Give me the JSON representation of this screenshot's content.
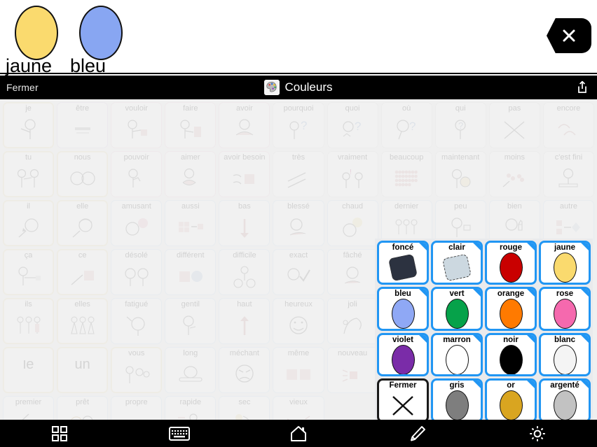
{
  "app": {
    "title": "Couleurs",
    "title_icon": "palette-icon"
  },
  "message_bar": {
    "items": [
      {
        "label": "jaune",
        "color": "#FADA6E"
      },
      {
        "label": "bleu",
        "color": "#88A6F2"
      }
    ],
    "clear_label": "clear-x-icon"
  },
  "title_bar": {
    "close_label": "Fermer",
    "share_icon": "share-icon"
  },
  "color_popup": {
    "cells": [
      {
        "label": "foncé",
        "color": "#2c3240",
        "shape": "rotsq",
        "type": "color"
      },
      {
        "label": "clair",
        "color": "#ccd8e0",
        "shape": "rotsq",
        "type": "color"
      },
      {
        "label": "rouge",
        "color": "#C90000",
        "shape": "oval",
        "type": "color"
      },
      {
        "label": "jaune",
        "color": "#FADA6E",
        "shape": "oval",
        "type": "color"
      },
      {
        "label": "bleu",
        "color": "#8FA8F5",
        "shape": "oval",
        "type": "color"
      },
      {
        "label": "vert",
        "color": "#06A24A",
        "shape": "oval",
        "type": "color"
      },
      {
        "label": "orange",
        "color": "#FF7A00",
        "shape": "oval",
        "type": "color"
      },
      {
        "label": "rose",
        "color": "#F569AE",
        "shape": "oval",
        "type": "color"
      },
      {
        "label": "violet",
        "color": "#7A2CA8",
        "shape": "oval",
        "type": "color"
      },
      {
        "label": "marron",
        "color": "#8C6murky",
        "shape": "oval",
        "type": "color"
      },
      {
        "label": "noir",
        "color": "#000000",
        "shape": "oval",
        "type": "color"
      },
      {
        "label": "blanc",
        "color": "#F4F4F4",
        "shape": "oval",
        "type": "color"
      },
      {
        "label": "Fermer",
        "color": "#000000",
        "shape": "cross",
        "type": "close"
      },
      {
        "label": "gris",
        "color": "#7E7E7E",
        "shape": "oval",
        "type": "color"
      },
      {
        "label": "or",
        "color": "#D9A520",
        "shape": "oval",
        "type": "color"
      },
      {
        "label": "argenté",
        "color": "#C2C2C2",
        "shape": "oval",
        "type": "color"
      }
    ]
  },
  "board": {
    "rows": [
      [
        {
          "label": "je",
          "tint": "yellow",
          "art": "person-point-self"
        },
        {
          "label": "être",
          "tint": "purple",
          "art": "equals-bar"
        },
        {
          "label": "vouloir",
          "tint": "pink",
          "art": "person-reach-box"
        },
        {
          "label": "faire",
          "tint": "pink",
          "art": "person-build"
        },
        {
          "label": "avoir",
          "tint": "pink",
          "art": "person-hold"
        },
        {
          "label": "pourquoi",
          "tint": "grey",
          "art": "person-question"
        },
        {
          "label": "quoi",
          "tint": "grey",
          "art": "face-question"
        },
        {
          "label": "où",
          "tint": "grey",
          "art": "balloon-question"
        },
        {
          "label": "qui",
          "tint": "grey",
          "art": "person-question2"
        },
        {
          "label": "pas",
          "tint": "grey",
          "art": "cross-slash"
        },
        {
          "label": "encore",
          "tint": "grey",
          "art": "arrows-repeat"
        }
      ],
      [
        {
          "label": "tu",
          "tint": "yellow",
          "art": "two-people-point"
        },
        {
          "label": "nous",
          "tint": "yellow",
          "art": "two-faces"
        },
        {
          "label": "pouvoir",
          "tint": "pink",
          "art": "person-flex"
        },
        {
          "label": "aimer",
          "tint": "pink",
          "art": "person-heart"
        },
        {
          "label": "avoir besoin",
          "tint": "pink",
          "art": "hands-box"
        },
        {
          "label": "très",
          "tint": "grey",
          "art": "lines-up"
        },
        {
          "label": "vraiment",
          "tint": "grey",
          "art": "two-people-talk"
        },
        {
          "label": "beaucoup",
          "tint": "grey",
          "art": "many-dots"
        },
        {
          "label": "maintenant",
          "tint": "grey",
          "art": "person-clock"
        },
        {
          "label": "moins",
          "tint": "grey",
          "art": "scatter-less"
        },
        {
          "label": "c'est fini",
          "tint": "grey",
          "art": "person-done"
        }
      ],
      [
        {
          "label": "il",
          "tint": "yellow",
          "art": "boy-face-arrow"
        },
        {
          "label": "elle",
          "tint": "yellow",
          "art": "girl-face-arrow"
        },
        {
          "label": "amusant",
          "tint": "blue",
          "art": "face-laugh"
        },
        {
          "label": "aussi",
          "tint": "blue",
          "art": "blocks-arrow"
        },
        {
          "label": "bas",
          "tint": "blue",
          "art": "arrow-down"
        },
        {
          "label": "blessé",
          "tint": "blue",
          "art": "face-hurt"
        },
        {
          "label": "chaud",
          "tint": "blue",
          "art": "face-sun"
        },
        {
          "label": "dernier",
          "tint": "blue",
          "art": "people-line"
        },
        {
          "label": "peu",
          "tint": "blue",
          "art": "person-small"
        },
        {
          "label": "bien",
          "tint": "blue",
          "art": "thumbs-up"
        },
        {
          "label": "autre",
          "tint": "blue",
          "art": "shapes-arrow"
        }
      ],
      [
        {
          "label": "ça",
          "tint": "yellow",
          "art": "person-point-box"
        },
        {
          "label": "ce",
          "tint": "yellow",
          "art": "arrow-box"
        },
        {
          "label": "désolé",
          "tint": "blue",
          "art": "two-faces-sorry"
        },
        {
          "label": "différent",
          "tint": "blue",
          "art": "square-circle"
        },
        {
          "label": "difficile",
          "tint": "blue",
          "art": "person-machine"
        },
        {
          "label": "exact",
          "tint": "blue",
          "art": "face-check"
        },
        {
          "label": "fâché",
          "tint": "blue",
          "art": "face-angry"
        }
      ],
      [
        {
          "label": "ils",
          "tint": "yellow",
          "art": "three-people"
        },
        {
          "label": "elles",
          "tint": "yellow",
          "art": "three-women"
        },
        {
          "label": "fatigué",
          "tint": "blue",
          "art": "person-tired"
        },
        {
          "label": "gentil",
          "tint": "blue",
          "art": "person-kind"
        },
        {
          "label": "haut",
          "tint": "blue",
          "art": "arrow-up"
        },
        {
          "label": "heureux",
          "tint": "blue",
          "art": "face-happy"
        },
        {
          "label": "joli",
          "tint": "blue",
          "art": "peacock"
        }
      ],
      [
        {
          "label": "le",
          "tint": "yellow",
          "art": "text-only"
        },
        {
          "label": "un",
          "tint": "yellow",
          "art": "text-only"
        },
        {
          "label": "vous",
          "tint": "yellow",
          "art": "person-point-others"
        },
        {
          "label": "long",
          "tint": "blue",
          "art": "long-car"
        },
        {
          "label": "méchant",
          "tint": "blue",
          "art": "face-mean"
        },
        {
          "label": "même",
          "tint": "blue",
          "art": "two-squares"
        },
        {
          "label": "nouveau",
          "tint": "blue",
          "art": "shiny-box"
        }
      ],
      [
        {
          "label": "premier",
          "tint": "blue",
          "art": "numbers-123"
        },
        {
          "label": "prêt",
          "tint": "blue",
          "art": "person-ready"
        },
        {
          "label": "propre",
          "tint": "blue",
          "art": "hands-clean"
        },
        {
          "label": "rapide",
          "tint": "blue",
          "art": "person-run"
        },
        {
          "label": "sec",
          "tint": "blue",
          "art": "towel-dry"
        },
        {
          "label": "vieux",
          "tint": "blue",
          "art": "old-box"
        }
      ]
    ]
  },
  "toolbar": {
    "buttons": [
      {
        "name": "grid-icon",
        "label": "Vocabulaire"
      },
      {
        "name": "keyboard-icon",
        "label": "Clavier"
      },
      {
        "name": "home-icon",
        "label": "Accueil"
      },
      {
        "name": "pencil-icon",
        "label": "Éditer"
      },
      {
        "name": "gear-icon",
        "label": "Réglages"
      }
    ]
  }
}
